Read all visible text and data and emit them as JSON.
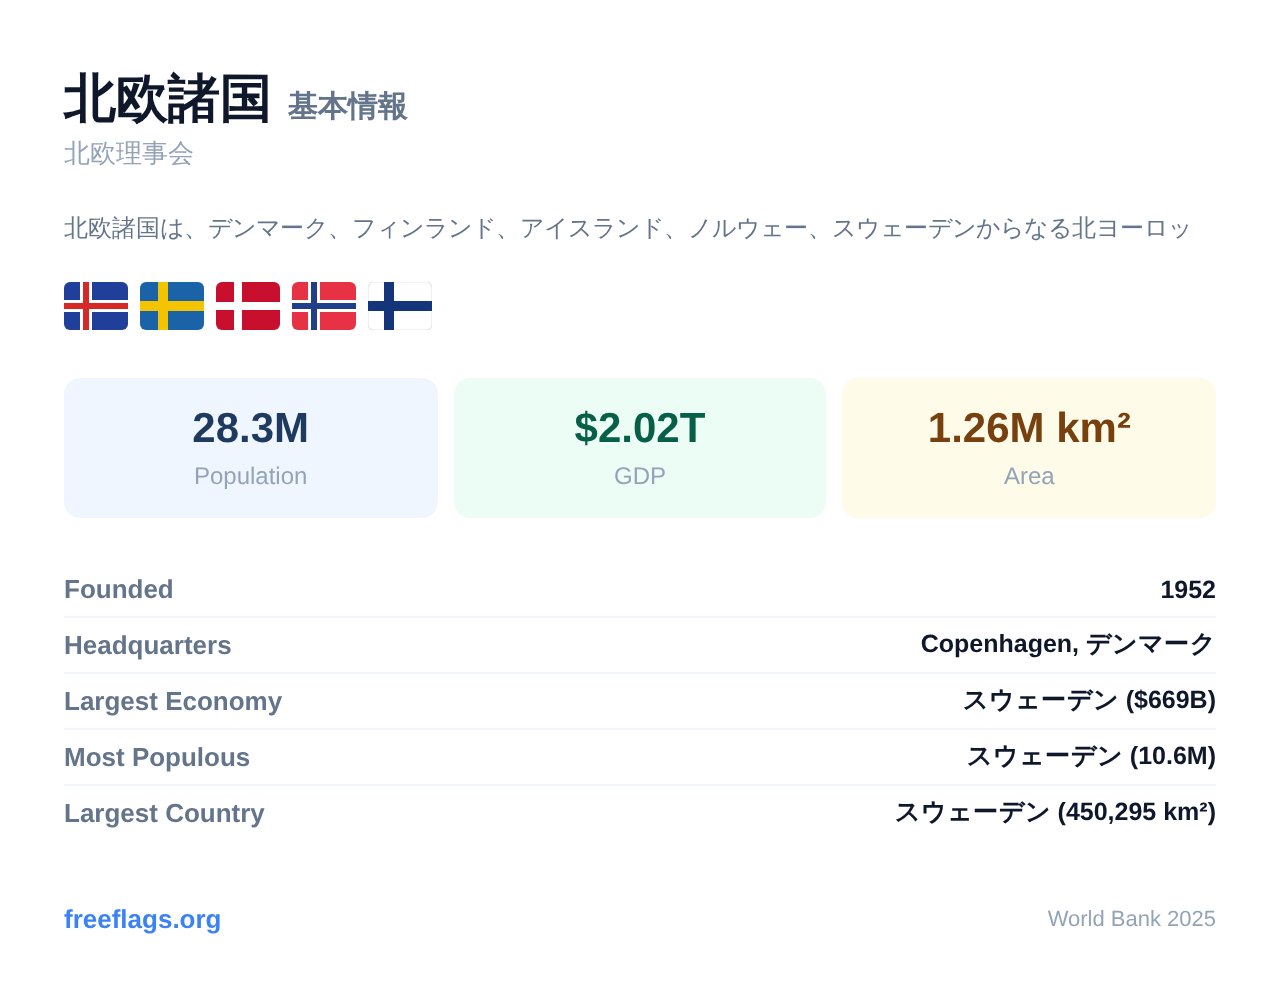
{
  "header": {
    "title": "北欧諸国",
    "tag": "基本情報",
    "subtitle": "北欧理事会"
  },
  "description": "北欧諸国は、デンマーク、フィンランド、アイスランド、ノルウェー、スウェーデンからなる北ヨーロッ",
  "stats": [
    {
      "value": "28.3M",
      "label": "Population",
      "color": "#1e3a5f"
    },
    {
      "value": "$2.02T",
      "label": "GDP",
      "color": "#065f46"
    },
    {
      "value": "1.26M km²",
      "label": "Area",
      "color": "#78400f"
    }
  ],
  "facts": [
    {
      "label": "Founded",
      "value": "1952"
    },
    {
      "label": "Headquarters",
      "value": "Copenhagen, デンマーク"
    },
    {
      "label": "Largest Economy",
      "value": "スウェーデン ($669B)"
    },
    {
      "label": "Most Populous",
      "value": "スウェーデン (10.6M)"
    },
    {
      "label": "Largest Country",
      "value": "スウェーデン (450,295 km²)"
    }
  ],
  "footer": {
    "link": "freeflags.org",
    "source": "World Bank 2025"
  }
}
